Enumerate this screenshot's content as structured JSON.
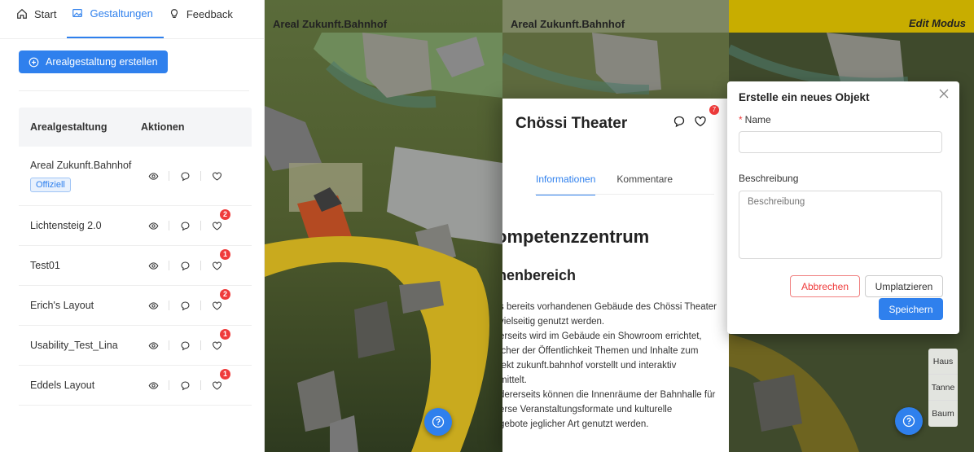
{
  "nav": {
    "start": "Start",
    "gestaltungen": "Gestaltungen",
    "feedback": "Feedback"
  },
  "create_button": "Arealgestaltung erstellen",
  "table": {
    "header_name": "Arealgestaltung",
    "header_actions": "Aktionen",
    "rows": [
      {
        "name": "Areal Zukunft.Bahnhof",
        "tag": "Offiziell",
        "badge": ""
      },
      {
        "name": "Lichtensteig 2.0",
        "badge": "2"
      },
      {
        "name": "Test01",
        "badge": "1"
      },
      {
        "name": "Erich's Layout",
        "badge": "2"
      },
      {
        "name": "Usability_Test_Lina",
        "badge": "1"
      },
      {
        "name": "Eddels Layout",
        "badge": "1"
      }
    ]
  },
  "map1": {
    "title": "Areal Zukunft.Bahnhof"
  },
  "map2": {
    "title": "Areal Zukunft.Bahnhof",
    "panel": {
      "title": "Chössi Theater",
      "badge": "7",
      "tabs": [
        "Informationen",
        "Kommentare"
      ],
      "heading1": "ompetenzzentrum",
      "heading2": "nenbereich",
      "lines": [
        "s bereits vorhandenen Gebäude des Chössi Theater",
        " vielseitig genutzt werden.",
        "erseits wird im Gebäude ein Showroom errichtet,",
        "icher der Öffentlichkeit Themen und Inhalte zum",
        "jekt zukunft.bahnhof vorstellt und interaktiv",
        "mittelt.",
        "dererseits können die Innenräume der Bahnhalle für",
        "erse Veranstaltungsformate und kulturelle",
        "gebote jeglicher Art genutzt werden."
      ]
    }
  },
  "map3": {
    "mode": "Edit Modus",
    "dialog": {
      "title": "Erstelle ein neues Objekt",
      "name_label": "Name",
      "desc_label": "Beschreibung",
      "desc_placeholder": "Beschreibung",
      "cancel": "Abbrechen",
      "move": "Umplatzieren",
      "save": "Speichern"
    },
    "palette": [
      "Haus",
      "Tanne",
      "Baum"
    ]
  },
  "colors": {
    "accent": "#2f80ed",
    "badge": "#ef3b3b",
    "editbar": "#c8ad00"
  }
}
